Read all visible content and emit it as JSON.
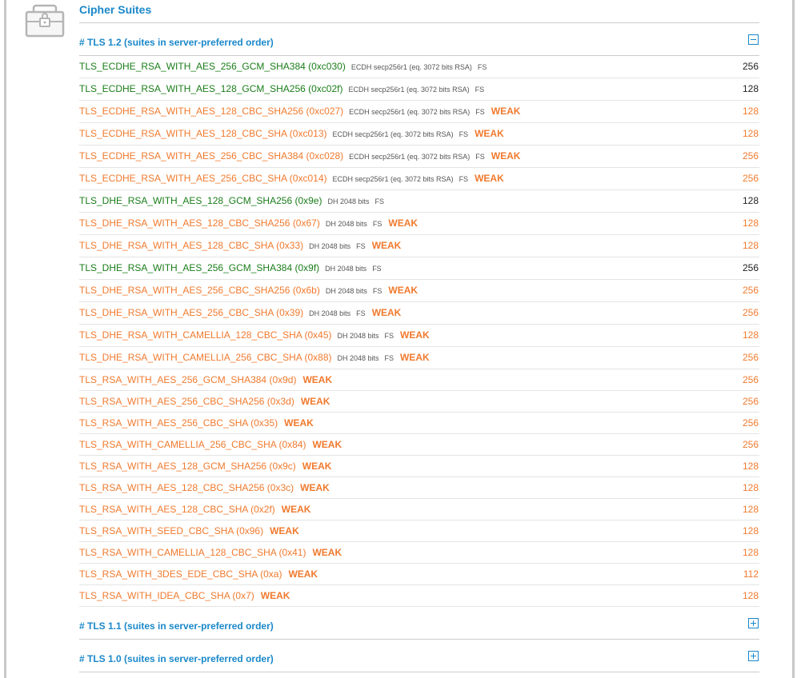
{
  "header": {
    "title": "Cipher Suites",
    "icon": "lock-suitcase-icon"
  },
  "colors": {
    "accent": "#1a88c9",
    "strong": "#1a7d1a",
    "weak": "#f07a2e"
  },
  "sections": [
    {
      "label": "# TLS 1.2 (suites in server-preferred order)",
      "expanded": true,
      "toggle": "collapse-icon"
    },
    {
      "label": "# TLS 1.1 (suites in server-preferred order)",
      "expanded": false,
      "toggle": "expand-icon"
    },
    {
      "label": "# TLS 1.0 (suites in server-preferred order)",
      "expanded": false,
      "toggle": "expand-icon"
    }
  ],
  "suites": [
    {
      "name": "TLS_ECDHE_RSA_WITH_AES_256_GCM_SHA384",
      "code": "(0xc030)",
      "kex": "ECDH secp256r1 (eq. 3072 bits RSA)",
      "fs": "FS",
      "weak": "",
      "bits": "256"
    },
    {
      "name": "TLS_ECDHE_RSA_WITH_AES_128_GCM_SHA256",
      "code": "(0xc02f)",
      "kex": "ECDH secp256r1 (eq. 3072 bits RSA)",
      "fs": "FS",
      "weak": "",
      "bits": "128"
    },
    {
      "name": "TLS_ECDHE_RSA_WITH_AES_128_CBC_SHA256",
      "code": "(0xc027)",
      "kex": "ECDH secp256r1 (eq. 3072 bits RSA)",
      "fs": "FS",
      "weak": "WEAK",
      "bits": "128"
    },
    {
      "name": "TLS_ECDHE_RSA_WITH_AES_128_CBC_SHA",
      "code": "(0xc013)",
      "kex": "ECDH secp256r1 (eq. 3072 bits RSA)",
      "fs": "FS",
      "weak": "WEAK",
      "bits": "128"
    },
    {
      "name": "TLS_ECDHE_RSA_WITH_AES_256_CBC_SHA384",
      "code": "(0xc028)",
      "kex": "ECDH secp256r1 (eq. 3072 bits RSA)",
      "fs": "FS",
      "weak": "WEAK",
      "bits": "256"
    },
    {
      "name": "TLS_ECDHE_RSA_WITH_AES_256_CBC_SHA",
      "code": "(0xc014)",
      "kex": "ECDH secp256r1 (eq. 3072 bits RSA)",
      "fs": "FS",
      "weak": "WEAK",
      "bits": "256"
    },
    {
      "name": "TLS_DHE_RSA_WITH_AES_128_GCM_SHA256",
      "code": "(0x9e)",
      "kex": "DH 2048 bits",
      "fs": "FS",
      "weak": "",
      "bits": "128"
    },
    {
      "name": "TLS_DHE_RSA_WITH_AES_128_CBC_SHA256",
      "code": "(0x67)",
      "kex": "DH 2048 bits",
      "fs": "FS",
      "weak": "WEAK",
      "bits": "128"
    },
    {
      "name": "TLS_DHE_RSA_WITH_AES_128_CBC_SHA",
      "code": "(0x33)",
      "kex": "DH 2048 bits",
      "fs": "FS",
      "weak": "WEAK",
      "bits": "128"
    },
    {
      "name": "TLS_DHE_RSA_WITH_AES_256_GCM_SHA384",
      "code": "(0x9f)",
      "kex": "DH 2048 bits",
      "fs": "FS",
      "weak": "",
      "bits": "256"
    },
    {
      "name": "TLS_DHE_RSA_WITH_AES_256_CBC_SHA256",
      "code": "(0x6b)",
      "kex": "DH 2048 bits",
      "fs": "FS",
      "weak": "WEAK",
      "bits": "256"
    },
    {
      "name": "TLS_DHE_RSA_WITH_AES_256_CBC_SHA",
      "code": "(0x39)",
      "kex": "DH 2048 bits",
      "fs": "FS",
      "weak": "WEAK",
      "bits": "256"
    },
    {
      "name": "TLS_DHE_RSA_WITH_CAMELLIA_128_CBC_SHA",
      "code": "(0x45)",
      "kex": "DH 2048 bits",
      "fs": "FS",
      "weak": "WEAK",
      "bits": "128"
    },
    {
      "name": "TLS_DHE_RSA_WITH_CAMELLIA_256_CBC_SHA",
      "code": "(0x88)",
      "kex": "DH 2048 bits",
      "fs": "FS",
      "weak": "WEAK",
      "bits": "256"
    },
    {
      "name": "TLS_RSA_WITH_AES_256_GCM_SHA384",
      "code": "(0x9d)",
      "kex": "",
      "fs": "",
      "weak": "WEAK",
      "bits": "256"
    },
    {
      "name": "TLS_RSA_WITH_AES_256_CBC_SHA256",
      "code": "(0x3d)",
      "kex": "",
      "fs": "",
      "weak": "WEAK",
      "bits": "256"
    },
    {
      "name": "TLS_RSA_WITH_AES_256_CBC_SHA",
      "code": "(0x35)",
      "kex": "",
      "fs": "",
      "weak": "WEAK",
      "bits": "256"
    },
    {
      "name": "TLS_RSA_WITH_CAMELLIA_256_CBC_SHA",
      "code": "(0x84)",
      "kex": "",
      "fs": "",
      "weak": "WEAK",
      "bits": "256"
    },
    {
      "name": "TLS_RSA_WITH_AES_128_GCM_SHA256",
      "code": "(0x9c)",
      "kex": "",
      "fs": "",
      "weak": "WEAK",
      "bits": "128"
    },
    {
      "name": "TLS_RSA_WITH_AES_128_CBC_SHA256",
      "code": "(0x3c)",
      "kex": "",
      "fs": "",
      "weak": "WEAK",
      "bits": "128"
    },
    {
      "name": "TLS_RSA_WITH_AES_128_CBC_SHA",
      "code": "(0x2f)",
      "kex": "",
      "fs": "",
      "weak": "WEAK",
      "bits": "128"
    },
    {
      "name": "TLS_RSA_WITH_SEED_CBC_SHA",
      "code": "(0x96)",
      "kex": "",
      "fs": "",
      "weak": "WEAK",
      "bits": "128"
    },
    {
      "name": "TLS_RSA_WITH_CAMELLIA_128_CBC_SHA",
      "code": "(0x41)",
      "kex": "",
      "fs": "",
      "weak": "WEAK",
      "bits": "128"
    },
    {
      "name": "TLS_RSA_WITH_3DES_EDE_CBC_SHA",
      "code": "(0xa)",
      "kex": "",
      "fs": "",
      "weak": "WEAK",
      "bits": "112"
    },
    {
      "name": "TLS_RSA_WITH_IDEA_CBC_SHA",
      "code": "(0x7)",
      "kex": "",
      "fs": "",
      "weak": "WEAK",
      "bits": "128"
    }
  ]
}
